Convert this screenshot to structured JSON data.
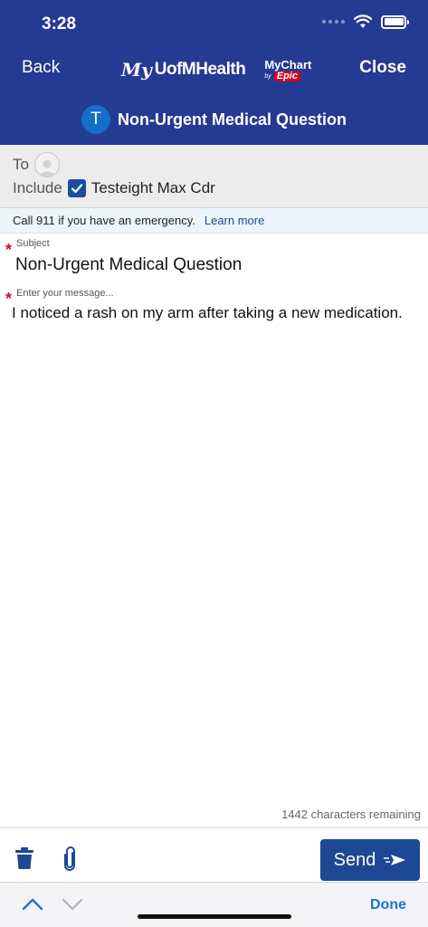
{
  "status_bar": {
    "time": "3:28"
  },
  "nav": {
    "back_label": "Back",
    "close_label": "Close",
    "logo": {
      "my": "My",
      "org": "UofMHealth",
      "mychart": "MyChart",
      "by": "by",
      "epic": "Epic"
    }
  },
  "title": {
    "avatar_letter": "T",
    "text": "Non-Urgent Medical Question"
  },
  "recipients": {
    "to_label": "To",
    "include_label": "Include",
    "include_checked": true,
    "include_name": "Testeight Max Cdr"
  },
  "banner": {
    "text": "Call 911 if you have an emergency.",
    "link": "Learn more"
  },
  "form": {
    "required_mark": "*",
    "subject_label": "Subject",
    "subject_value": "Non-Urgent Medical Question",
    "message_placeholder": "Enter your message...",
    "message_value": "I noticed a rash on my arm after taking a new medication."
  },
  "chars_remaining": "1442 characters remaining",
  "toolbar": {
    "trash_icon": "trash-icon",
    "attach_icon": "paperclip-icon",
    "send_label": "Send"
  },
  "keyboard_bar": {
    "done_label": "Done"
  },
  "colors": {
    "header": "#253a93",
    "send": "#1d4894",
    "link": "#1b4c8e",
    "required": "#c8102e",
    "done": "#1a73d9"
  }
}
